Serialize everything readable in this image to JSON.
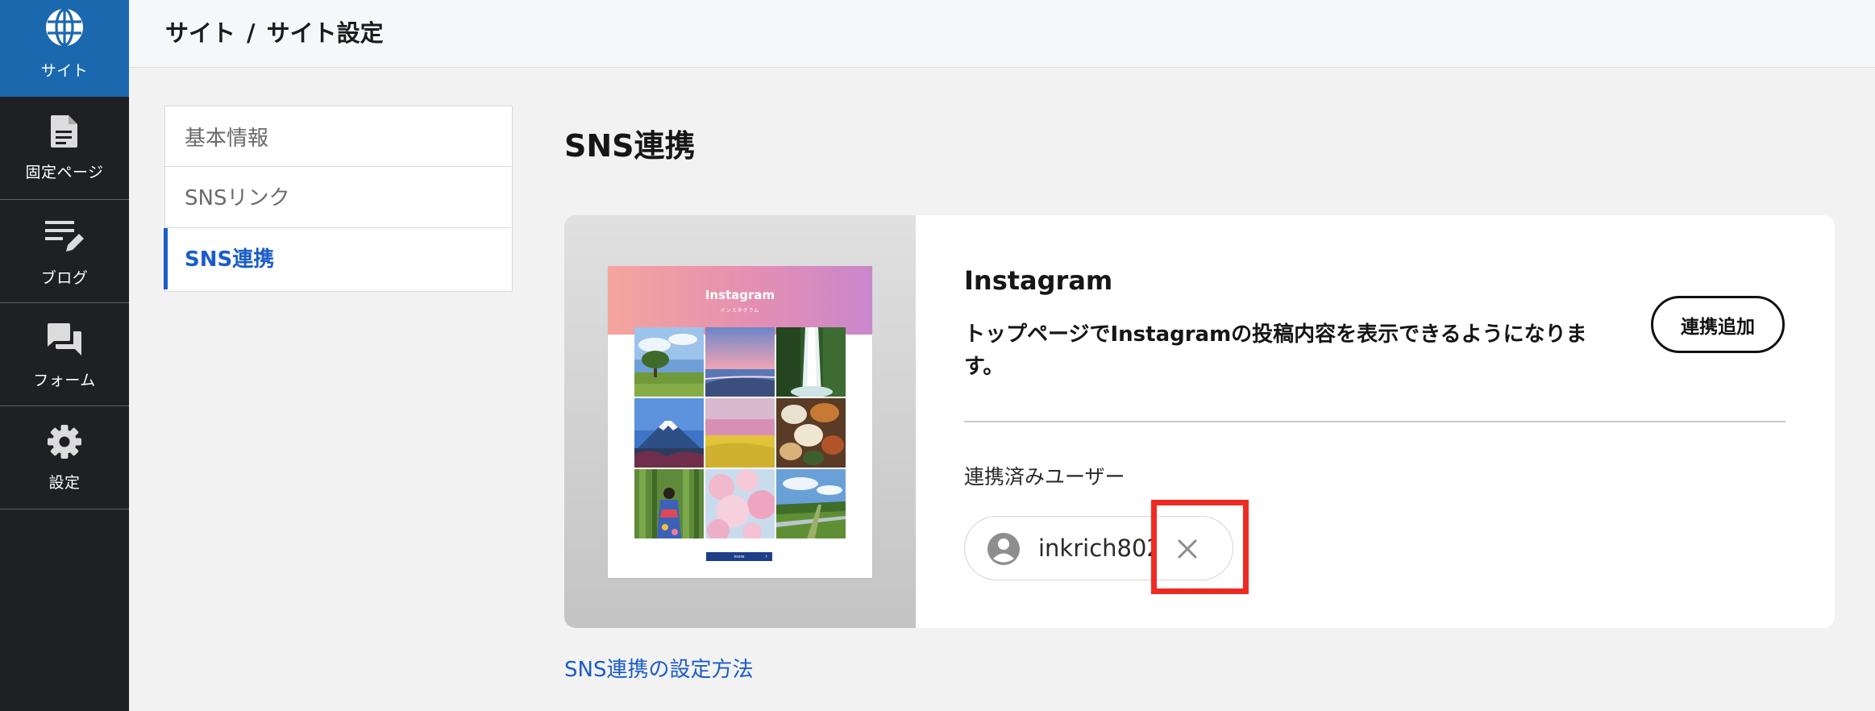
{
  "nav": {
    "items": [
      {
        "label": "サイト",
        "icon": "globe-icon",
        "active": true
      },
      {
        "label": "固定ページ",
        "icon": "document-icon",
        "active": false
      },
      {
        "label": "ブログ",
        "icon": "edit-list-icon",
        "active": false
      },
      {
        "label": "フォーム",
        "icon": "chat-bubbles-icon",
        "active": false
      },
      {
        "label": "設定",
        "icon": "gear-icon",
        "active": false
      }
    ]
  },
  "header": {
    "breadcrumb": [
      "サイト",
      "サイト設定"
    ],
    "separator": "/"
  },
  "submenu": {
    "items": [
      {
        "label": "基本情報",
        "active": false
      },
      {
        "label": "SNSリンク",
        "active": false
      },
      {
        "label": "SNS連携",
        "active": true
      }
    ]
  },
  "main": {
    "title": "SNS連携",
    "card": {
      "preview": {
        "title": "Instagram",
        "subtitle": "インスタグラム",
        "button_label": "more"
      },
      "name": "Instagram",
      "description": "トップページでInstagramの投稿内容を表示できるようになります。",
      "add_button": "連携追加",
      "linked_label": "連携済みユーザー",
      "linked_users": [
        {
          "name": "inkrich802",
          "avatar_icon": "user-avatar-icon",
          "remove_icon": "close-icon"
        }
      ]
    },
    "help_link": "SNS連携の設定方法"
  },
  "colors": {
    "nav_bg": "#1f2024",
    "nav_active": "#1c68ae",
    "link": "#1b5cc7",
    "highlight": "#ef2a22"
  }
}
